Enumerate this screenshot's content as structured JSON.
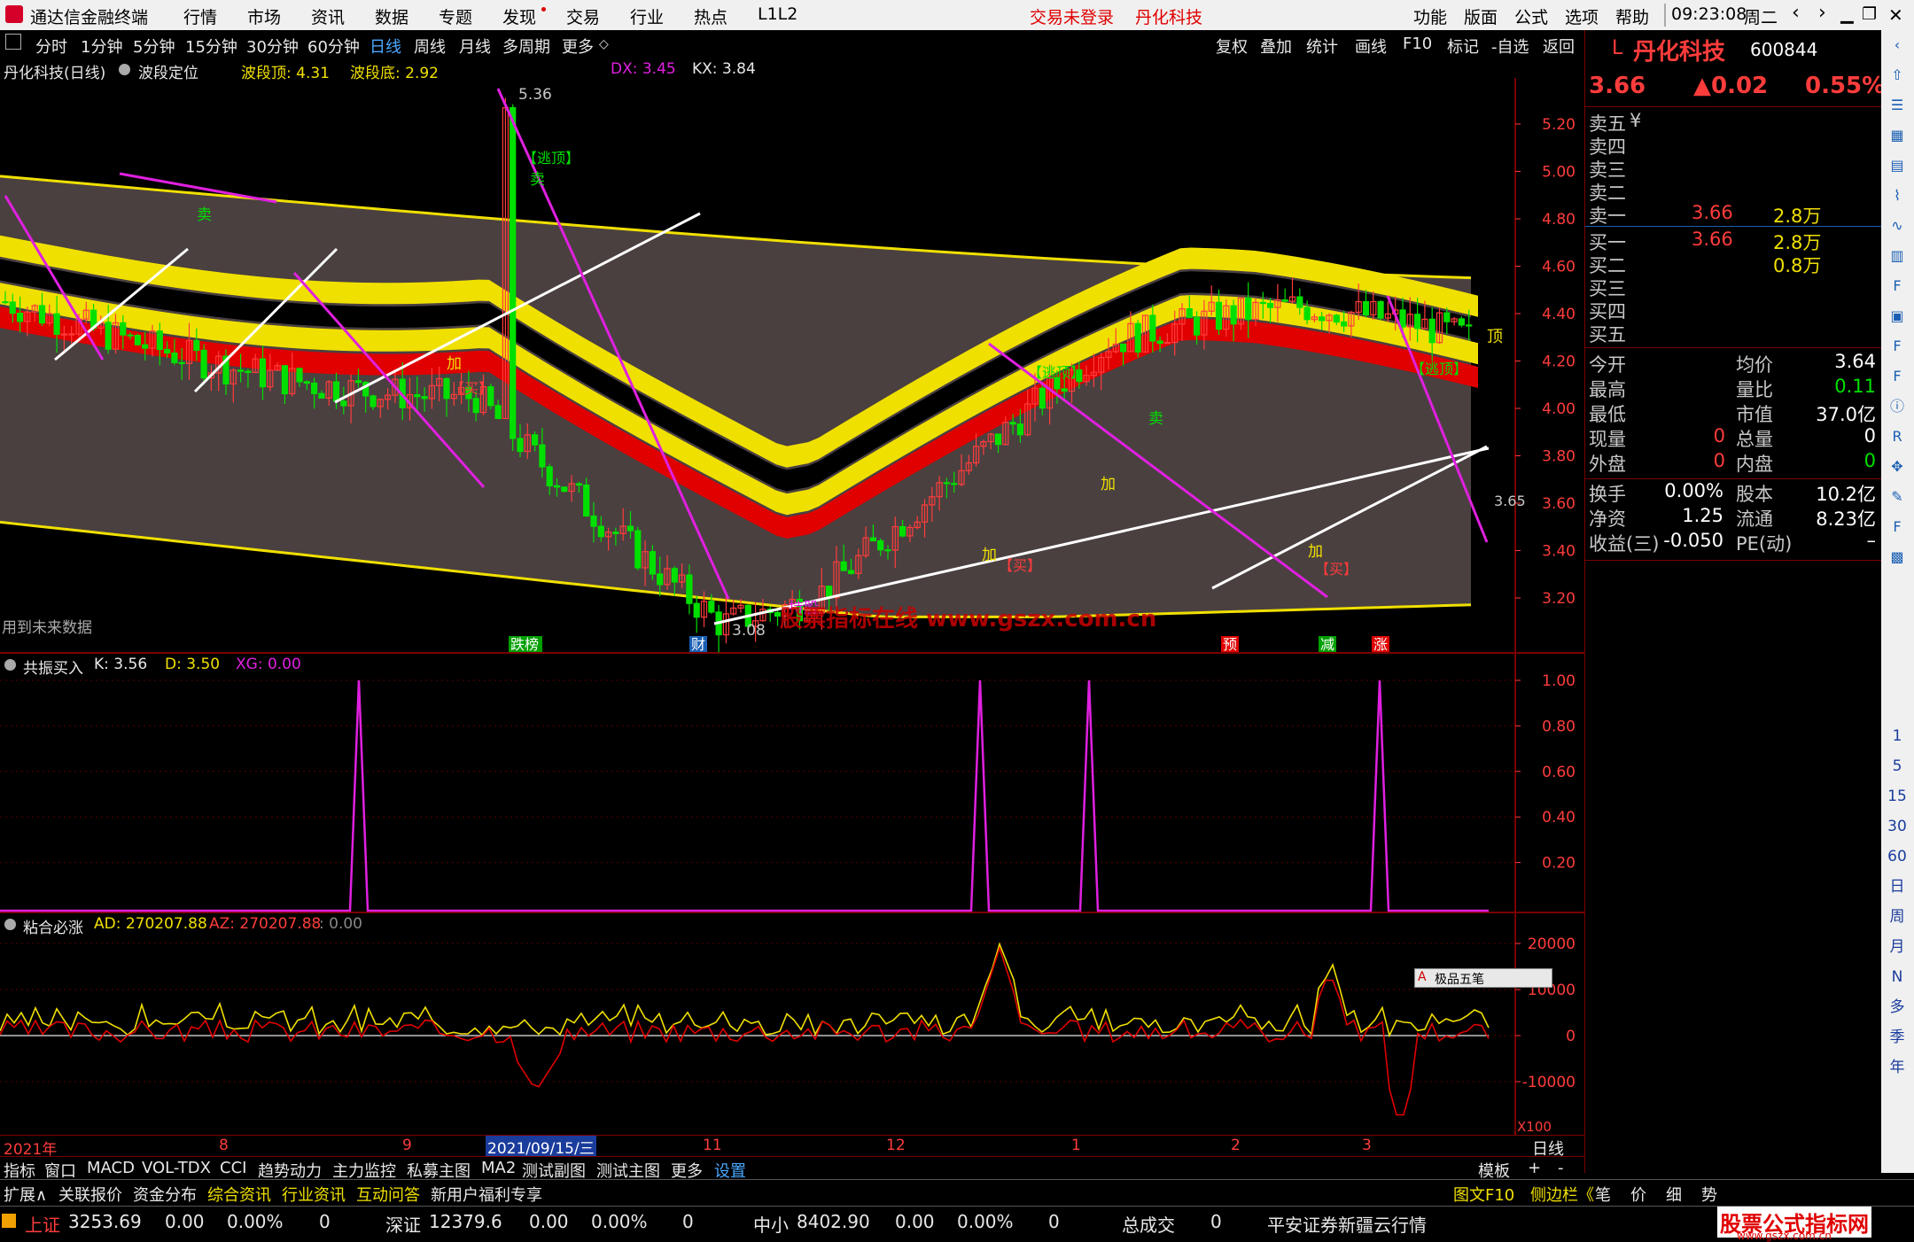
{
  "app": {
    "title": "通达信金融终端",
    "menu": [
      "行情",
      "市场",
      "资讯",
      "数据",
      "专题",
      "发现",
      "交易",
      "行业",
      "热点",
      "L1L2"
    ],
    "login_status": "交易未登录",
    "stock_title": "丹化科技",
    "right_menu": [
      "功能",
      "版面",
      "公式",
      "选项",
      "帮助"
    ],
    "time": "09:23:08",
    "weekday": "周二"
  },
  "periods": {
    "items": [
      "分时",
      "1分钟",
      "5分钟",
      "15分钟",
      "30分钟",
      "60分钟",
      "日线",
      "周线",
      "月线",
      "多周期",
      "更多"
    ],
    "active": "日线",
    "right_tools": [
      "复权",
      "叠加",
      "统计",
      "画线",
      "F10",
      "标记",
      "-自选",
      "返回"
    ]
  },
  "main_chart": {
    "name": "丹化科技(日线)",
    "indicator": "波段定位",
    "wave_top_label": "波段顶: 4.31",
    "wave_bottom_label": "波段底: 2.92",
    "dx_label": "DX: 3.45",
    "kx_label": "KX: 3.84",
    "price_axis": [
      "5.20",
      "5.00",
      "4.80",
      "4.60",
      "4.40",
      "4.20",
      "4.00",
      "3.80",
      "3.60",
      "3.40",
      "3.20"
    ],
    "last_price_tag": "3.65",
    "high_label": "5.36",
    "low_label": "3.08",
    "future_note": "用到未来数据",
    "watermark": "股票指标在线 www.gszx.com.cn",
    "top_marker": "顶",
    "event_markers": [
      "跌榜",
      "财",
      "预",
      "减",
      "涨"
    ],
    "annotations": {
      "escape_top": "【逃顶】",
      "sell": "卖",
      "add": "加",
      "buy": "【买】",
      "hold": "持股",
      "buy2": "【买】"
    }
  },
  "sub1": {
    "title": "共振买入",
    "k_label": "K: 3.56",
    "d_label": "D: 3.50",
    "xg_label": "XG: 0.00",
    "axis": [
      "1.00",
      "0.80",
      "0.60",
      "0.40",
      "0.20"
    ]
  },
  "sub2": {
    "title": "粘合必涨",
    "ad_label": "AD: 270207.88",
    "az_label": "AZ: 270207.88",
    "zero_label": ": 0.00",
    "axis": [
      "20000",
      "10000",
      "0",
      "-10000"
    ],
    "scale_label": "X100",
    "draw_toolbar": "极品五笔"
  },
  "time_axis": {
    "labels": [
      "2021年",
      "8",
      "9",
      "2021/09/15/三",
      "11",
      "12",
      "1",
      "2",
      "3"
    ],
    "period": "日线"
  },
  "bottom_tabs": [
    "指标",
    "窗口",
    "MACD",
    "VOL-TDX",
    "CCI",
    "趋势动力",
    "主力监控",
    "私募主图",
    "MA2",
    "测试副图",
    "测试主图",
    "更多",
    "设置"
  ],
  "bottom_tabs_right": [
    "模板",
    "+",
    "-"
  ],
  "lower_tabs": [
    "扩展∧",
    "关联报价",
    "资金分布",
    "综合资讯",
    "行业资讯",
    "互动问答",
    "新用户福利专享"
  ],
  "lower_tabs_right": [
    "图文F10",
    "侧边栏《",
    "笔",
    "价",
    "细",
    "势"
  ],
  "quote": {
    "market_char": "L",
    "name": "丹化科技",
    "code": "600844",
    "price": "3.66",
    "change": "▲0.02",
    "change_pct": "0.55%",
    "sell_levels": [
      {
        "label": "卖五",
        "price": "",
        "vol": "",
        "suffix": "¥"
      },
      {
        "label": "卖四",
        "price": "",
        "vol": ""
      },
      {
        "label": "卖三",
        "price": "",
        "vol": ""
      },
      {
        "label": "卖二",
        "price": "",
        "vol": ""
      },
      {
        "label": "卖一",
        "price": "3.66",
        "vol": "2.8万"
      }
    ],
    "buy_levels": [
      {
        "label": "买一",
        "price": "3.66",
        "vol": "2.8万"
      },
      {
        "label": "买二",
        "price": "",
        "vol": "0.8万"
      },
      {
        "label": "买三",
        "price": "",
        "vol": ""
      },
      {
        "label": "买四",
        "price": "",
        "vol": ""
      },
      {
        "label": "买五",
        "price": "",
        "vol": ""
      }
    ],
    "stats": [
      {
        "l1": "今开",
        "v1": "",
        "l2": "均价",
        "v2": "3.64"
      },
      {
        "l1": "最高",
        "v1": "",
        "l2": "量比",
        "v2": "0.11"
      },
      {
        "l1": "最低",
        "v1": "",
        "l2": "市值",
        "v2": "37.0亿"
      },
      {
        "l1": "现量",
        "v1": "0",
        "l2": "总量",
        "v2": "0"
      },
      {
        "l1": "外盘",
        "v1": "0",
        "l2": "内盘",
        "v2": "0"
      }
    ],
    "fund": [
      {
        "l1": "换手",
        "v1": "0.00%",
        "l2": "股本",
        "v2": "10.2亿"
      },
      {
        "l1": "净资",
        "v1": "1.25",
        "l2": "流通",
        "v2": "8.23亿"
      },
      {
        "l1": "收益(三)",
        "v1": "-0.050",
        "l2": "PE(动)",
        "v2": "–"
      }
    ]
  },
  "side_icons": [
    "back-icon",
    "up-icon",
    "list-icon",
    "chart-icon",
    "table-icon",
    "kline-icon",
    "trend-icon",
    "finance-icon",
    "f10-icon",
    "news-icon",
    "f-icon",
    "fz-icon",
    "info-icon",
    "rsi-icon",
    "move-icon",
    "pen-icon",
    "fs-icon",
    "lock-icon"
  ],
  "side_periods": [
    "1",
    "5",
    "15",
    "30",
    "60",
    "日",
    "周",
    "月",
    "N",
    "多",
    "季",
    "年"
  ],
  "statusbar": {
    "sh_label": "上证",
    "sh_value": "3253.69",
    "sh_change": "0.00",
    "sh_pct": "0.00%",
    "sh_vol": "0",
    "sz_label": "深证",
    "sz_value": "12379.6",
    "sz_change": "0.00",
    "sz_pct": "0.00%",
    "sz_vol": "0",
    "zx_label": "中小",
    "zx_value": "8402.90",
    "zx_change": "0.00",
    "zx_pct": "0.00%",
    "zx_vol": "0",
    "total_label": "总成交",
    "total_value": "0",
    "broker": "平安证券新疆云行情",
    "brand": "股票公式指标网",
    "brand_url": "www.gszx.com.cn"
  },
  "colors": {
    "up": "#ff3c3c",
    "down": "#00e000",
    "yellow": "#f0e000",
    "magenta": "#e020e0",
    "band_bg": "#4a4040"
  }
}
